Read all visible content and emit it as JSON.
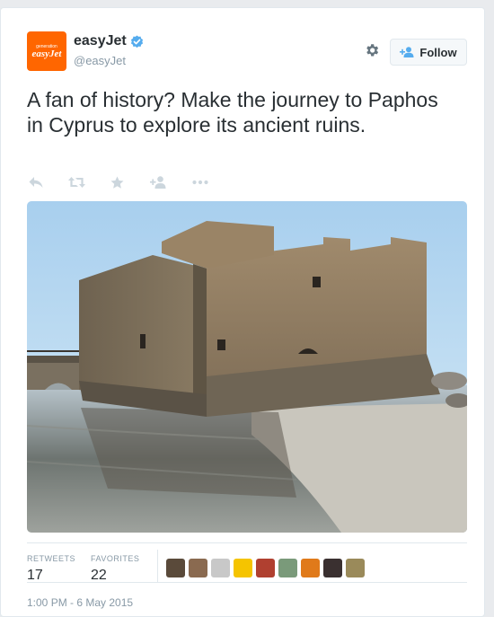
{
  "header": {
    "avatar_small": "generation",
    "avatar_brand": "easyJet",
    "name": "easyJet",
    "handle": "@easyJet",
    "follow_label": "Follow",
    "brand_color": "#ff6600",
    "verified_color": "#55acee"
  },
  "tweet": {
    "text": "A fan of history? Make the journey to Paphos in Cyprus to explore its ancient ruins."
  },
  "actions": {
    "icons": [
      "reply-icon",
      "retweet-icon",
      "favorite-icon",
      "follow-icon",
      "more-icon"
    ]
  },
  "stats": {
    "retweets_label": "RETWEETS",
    "retweets_count": "17",
    "favorites_label": "FAVORITES",
    "favorites_count": "22"
  },
  "favoriters": [
    {
      "color": "#5a4a3a"
    },
    {
      "color": "#8a6a50"
    },
    {
      "color": "#c8c8c8"
    },
    {
      "color": "#f5c400"
    },
    {
      "color": "#b04030"
    },
    {
      "color": "#7a9a7a"
    },
    {
      "color": "#e07a1a"
    },
    {
      "color": "#3a3030"
    },
    {
      "color": "#9a8a5a"
    }
  ],
  "timestamp": "1:00 PM - 6 May 2015"
}
